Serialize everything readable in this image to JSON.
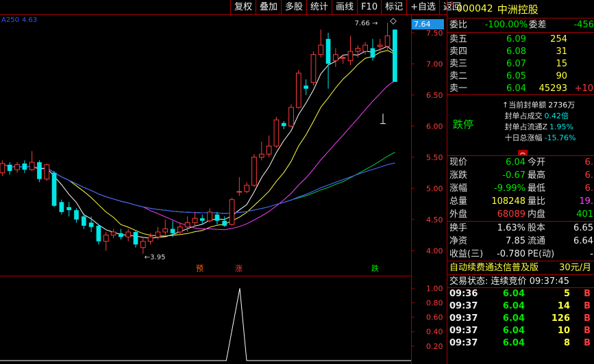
{
  "toolbar": {
    "items": [
      "复权",
      "叠加",
      "多股",
      "统计",
      "画线",
      "F10",
      "标记",
      "+自选",
      "返回"
    ]
  },
  "indicator": {
    "label": "A250",
    "value": "4.63"
  },
  "current_price_tag": "7.64",
  "stock": {
    "mark": "R",
    "code": "000042",
    "name": "中洲控股"
  },
  "committee": {
    "ratio_label": "委比",
    "ratio_value": "-100.00%",
    "diff_label": "委差",
    "diff_value": "-456"
  },
  "order_book": [
    {
      "label": "卖五",
      "price": "6.09",
      "volume": "254",
      "extra": ""
    },
    {
      "label": "卖四",
      "price": "6.08",
      "volume": "31",
      "extra": ""
    },
    {
      "label": "卖三",
      "price": "6.07",
      "volume": "15",
      "extra": ""
    },
    {
      "label": "卖二",
      "price": "6.05",
      "volume": "90",
      "extra": ""
    },
    {
      "label": "卖一",
      "price": "6.04",
      "volume": "45293",
      "extra": "+10"
    }
  ],
  "limit": {
    "title": "跌停",
    "lines": [
      {
        "label": "当前封单额",
        "value": "2736万"
      },
      {
        "label": "封单占成交",
        "value": "0.42倍"
      },
      {
        "label": "封单占流通Z",
        "value": "1.95%"
      },
      {
        "label": "十日总涨幅",
        "value": "-15.76%"
      }
    ]
  },
  "quote": [
    {
      "l1": "现价",
      "v1": "6.04",
      "l2": "今开",
      "v2": "6."
    },
    {
      "l1": "涨跌",
      "v1": "-0.67",
      "l2": "最高",
      "v2": "6."
    },
    {
      "l1": "涨幅",
      "v1": "-9.99%",
      "l2": "最低",
      "v2": "6."
    },
    {
      "l1": "总量",
      "v1": "108248",
      "l2": "量比",
      "v2": "19."
    },
    {
      "l1": "外盘",
      "v1": "68089",
      "l2": "内盘",
      "v2": "401"
    }
  ],
  "fundamentals": [
    {
      "l1": "换手",
      "v1": "1.63%",
      "l2": "股本",
      "v2": "6.65"
    },
    {
      "l1": "净资",
      "v1": "7.85",
      "l2": "流通",
      "v2": "6.64"
    },
    {
      "l1": "收益(三)",
      "v1": "-0.780",
      "l2": "PE(动)",
      "v2": "-"
    }
  ],
  "ad": {
    "text": "自动续费通达信普及版",
    "price": "30元/月"
  },
  "status": {
    "label": "交易状态:",
    "value": "连续竞价",
    "time": "09:37:45"
  },
  "ticks": [
    {
      "time": "09:36",
      "price": "6.04",
      "vol": "5",
      "side": "B"
    },
    {
      "time": "09:37",
      "price": "6.04",
      "vol": "14",
      "side": "B"
    },
    {
      "time": "09:37",
      "price": "6.04",
      "vol": "126",
      "side": "B"
    },
    {
      "time": "09:37",
      "price": "6.04",
      "vol": "10",
      "side": "B"
    },
    {
      "time": "09:37",
      "price": "6.04",
      "vol": "8",
      "side": "B"
    }
  ],
  "chart_data": [
    {
      "type": "candlestick",
      "y_ticks": [
        "7.50",
        "7.00",
        "6.50",
        "6.00",
        "5.50",
        "5.00",
        "4.50",
        "4.00"
      ],
      "ylim": [
        3.85,
        7.75
      ],
      "annotations": {
        "high": "7.66",
        "low": "3.95"
      },
      "markers": [
        "预",
        "涨",
        "跌"
      ],
      "candles": [
        {
          "o": 5.25,
          "c": 5.4,
          "h": 5.45,
          "l": 5.2
        },
        {
          "o": 5.38,
          "c": 5.28,
          "h": 5.42,
          "l": 5.22
        },
        {
          "o": 5.3,
          "c": 5.38,
          "h": 5.42,
          "l": 5.25
        },
        {
          "o": 5.4,
          "c": 5.3,
          "h": 5.45,
          "l": 5.25
        },
        {
          "o": 5.3,
          "c": 5.42,
          "h": 5.6,
          "l": 5.28
        },
        {
          "o": 5.42,
          "c": 5.15,
          "h": 5.45,
          "l": 5.1
        },
        {
          "o": 5.15,
          "c": 5.38,
          "h": 5.4,
          "l": 5.12
        },
        {
          "o": 5.25,
          "c": 4.72,
          "h": 5.28,
          "l": 4.7
        },
        {
          "o": 4.78,
          "c": 4.62,
          "h": 4.82,
          "l": 4.58
        },
        {
          "o": 4.7,
          "c": 4.65,
          "h": 4.78,
          "l": 4.55
        },
        {
          "o": 4.65,
          "c": 4.5,
          "h": 4.68,
          "l": 4.45
        },
        {
          "o": 4.55,
          "c": 4.4,
          "h": 4.6,
          "l": 4.35
        },
        {
          "o": 4.45,
          "c": 4.38,
          "h": 4.55,
          "l": 4.3
        },
        {
          "o": 4.4,
          "c": 4.15,
          "h": 4.42,
          "l": 4.1
        },
        {
          "o": 4.15,
          "c": 4.25,
          "h": 4.3,
          "l": 4.0
        },
        {
          "o": 4.25,
          "c": 4.3,
          "h": 4.35,
          "l": 4.2
        },
        {
          "o": 4.28,
          "c": 4.22,
          "h": 4.35,
          "l": 4.18
        },
        {
          "o": 4.22,
          "c": 4.3,
          "h": 4.35,
          "l": 4.15
        },
        {
          "o": 4.3,
          "c": 4.1,
          "h": 4.33,
          "l": 4.05
        },
        {
          "o": 4.05,
          "c": 4.15,
          "h": 4.2,
          "l": 3.95
        },
        {
          "o": 4.15,
          "c": 4.22,
          "h": 4.28,
          "l": 4.1
        },
        {
          "o": 4.22,
          "c": 4.3,
          "h": 4.38,
          "l": 4.18
        },
        {
          "o": 4.3,
          "c": 4.35,
          "h": 4.5,
          "l": 4.25
        },
        {
          "o": 4.35,
          "c": 4.28,
          "h": 4.48,
          "l": 4.22
        },
        {
          "o": 4.3,
          "c": 4.38,
          "h": 4.45,
          "l": 4.25
        },
        {
          "o": 4.38,
          "c": 4.45,
          "h": 4.55,
          "l": 4.3
        },
        {
          "o": 4.45,
          "c": 4.52,
          "h": 4.62,
          "l": 4.4
        },
        {
          "o": 4.52,
          "c": 4.48,
          "h": 4.58,
          "l": 4.42
        },
        {
          "o": 4.48,
          "c": 4.62,
          "h": 4.68,
          "l": 4.45
        },
        {
          "o": 4.58,
          "c": 4.48,
          "h": 4.62,
          "l": 4.42
        },
        {
          "o": 4.48,
          "c": 4.4,
          "h": 4.55,
          "l": 4.38
        },
        {
          "o": 4.42,
          "c": 4.82,
          "h": 4.85,
          "l": 4.4
        },
        {
          "o": 4.95,
          "c": 4.95,
          "h": 5.18,
          "l": 4.88
        },
        {
          "o": 4.95,
          "c": 5.05,
          "h": 5.1,
          "l": 4.92
        },
        {
          "o": 5.05,
          "c": 5.5,
          "h": 5.55,
          "l": 5.02
        },
        {
          "o": 5.5,
          "c": 5.55,
          "h": 5.75,
          "l": 5.45
        },
        {
          "o": 5.55,
          "c": 5.68,
          "h": 5.85,
          "l": 5.5
        },
        {
          "o": 5.68,
          "c": 6.1,
          "h": 6.15,
          "l": 5.65
        },
        {
          "o": 6.05,
          "c": 6.0,
          "h": 6.08,
          "l": 5.95
        },
        {
          "o": 6.0,
          "c": 6.3,
          "h": 6.35,
          "l": 5.98
        },
        {
          "o": 6.3,
          "c": 6.85,
          "h": 6.9,
          "l": 6.28
        },
        {
          "o": 6.65,
          "c": 6.6,
          "h": 6.75,
          "l": 6.5
        },
        {
          "o": 6.7,
          "c": 7.15,
          "h": 7.2,
          "l": 6.65
        },
        {
          "o": 7.15,
          "c": 7.3,
          "h": 7.55,
          "l": 7.1
        },
        {
          "o": 7.4,
          "c": 7.0,
          "h": 7.5,
          "l": 6.6
        },
        {
          "o": 7.05,
          "c": 7.15,
          "h": 7.25,
          "l": 6.95
        },
        {
          "o": 7.1,
          "c": 7.1,
          "h": 7.15,
          "l": 7.0
        },
        {
          "o": 7.05,
          "c": 7.2,
          "h": 7.45,
          "l": 6.98
        },
        {
          "o": 7.2,
          "c": 7.25,
          "h": 7.3,
          "l": 7.1
        },
        {
          "o": 7.2,
          "c": 7.3,
          "h": 7.35,
          "l": 7.15
        },
        {
          "o": 7.25,
          "c": 7.1,
          "h": 7.4,
          "l": 7.05
        },
        {
          "o": 7.28,
          "c": 7.3,
          "h": 7.4,
          "l": 7.2
        },
        {
          "o": 7.28,
          "c": 7.45,
          "h": 7.66,
          "l": 7.2
        },
        {
          "o": 7.55,
          "c": 6.71,
          "h": 7.55,
          "l": 6.71
        }
      ]
    },
    {
      "type": "line",
      "y_ticks": [
        "1.00",
        "0.80",
        "0.60",
        "0.40",
        "0.20"
      ],
      "ylim": [
        0,
        1.05
      ],
      "values": [
        0,
        0,
        0,
        0,
        0,
        0,
        0,
        0,
        0,
        0,
        0,
        0,
        0,
        0,
        0,
        0,
        0,
        0,
        0,
        0,
        0,
        0,
        0,
        0,
        0,
        0,
        0,
        0,
        0,
        0,
        0,
        0,
        0,
        0,
        0,
        1,
        0,
        0,
        0,
        0,
        0,
        0,
        0,
        0,
        0,
        0,
        0,
        0,
        0,
        0,
        0,
        0,
        0,
        0
      ]
    }
  ]
}
